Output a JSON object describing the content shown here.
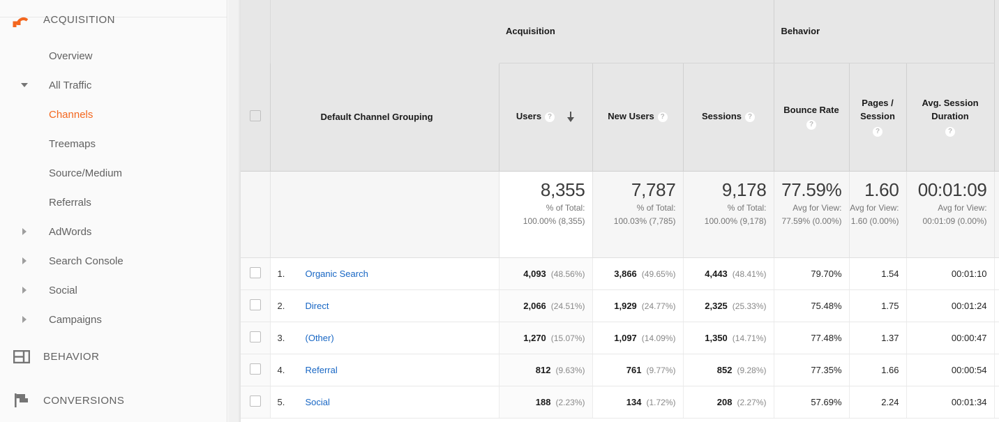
{
  "sidebar": {
    "sections": [
      {
        "label": "ACQUISITION",
        "icon": "acquisition-arrow-icon",
        "active": true
      },
      {
        "label": "BEHAVIOR",
        "icon": "behavior-layout-icon",
        "active": false
      },
      {
        "label": "CONVERSIONS",
        "icon": "conversions-flag-icon",
        "active": false
      }
    ],
    "items": [
      {
        "label": "Overview",
        "toggle": "none",
        "selected": false
      },
      {
        "label": "All Traffic",
        "toggle": "expanded",
        "selected": false
      },
      {
        "label": "Channels",
        "toggle": "none",
        "selected": true
      },
      {
        "label": "Treemaps",
        "toggle": "none",
        "selected": false
      },
      {
        "label": "Source/Medium",
        "toggle": "none",
        "selected": false
      },
      {
        "label": "Referrals",
        "toggle": "none",
        "selected": false
      },
      {
        "label": "AdWords",
        "toggle": "collapsed",
        "selected": false
      },
      {
        "label": "Search Console",
        "toggle": "collapsed",
        "selected": false
      },
      {
        "label": "Social",
        "toggle": "collapsed",
        "selected": false
      },
      {
        "label": "Campaigns",
        "toggle": "collapsed",
        "selected": false
      }
    ],
    "accent_color": "#f3671f"
  },
  "table": {
    "group_headers": {
      "acquisition": "Acquisition",
      "behavior": "Behavior"
    },
    "dimension_header": "Default Channel Grouping",
    "columns": [
      {
        "label": "Users",
        "help": "?",
        "sorted": true,
        "sort_dir": "descending"
      },
      {
        "label": "New Users",
        "help": "?",
        "sorted": false
      },
      {
        "label": "Sessions",
        "help": "?",
        "sorted": false
      },
      {
        "label": "Bounce Rate",
        "help": "?",
        "sorted": false
      },
      {
        "label": "Pages / Session",
        "help": "?",
        "sorted": false
      },
      {
        "label": "Avg. Session Duration",
        "help": "?",
        "sorted": false
      }
    ],
    "summary": [
      {
        "main": "8,355",
        "sub1": "% of Total:",
        "sub2": "100.00% (8,355)"
      },
      {
        "main": "7,787",
        "sub1": "% of Total:",
        "sub2": "100.03% (7,785)"
      },
      {
        "main": "9,178",
        "sub1": "% of Total:",
        "sub2": "100.00% (9,178)"
      },
      {
        "main": "77.59%",
        "sub1": "Avg for View:",
        "sub2": "77.59% (0.00%)"
      },
      {
        "main": "1.60",
        "sub1": "Avg for View:",
        "sub2": "1.60 (0.00%)"
      },
      {
        "main": "00:01:09",
        "sub1": "Avg for View:",
        "sub2": "00:01:09 (0.00%)"
      }
    ],
    "rows": [
      {
        "index": "1.",
        "channel": "Organic Search",
        "users": "4,093",
        "users_pct": "(48.56%)",
        "new_users": "3,866",
        "new_users_pct": "(49.65%)",
        "sessions": "4,443",
        "sessions_pct": "(48.41%)",
        "bounce_rate": "79.70%",
        "pages_session": "1.54",
        "avg_duration": "00:01:10"
      },
      {
        "index": "2.",
        "channel": "Direct",
        "users": "2,066",
        "users_pct": "(24.51%)",
        "new_users": "1,929",
        "new_users_pct": "(24.77%)",
        "sessions": "2,325",
        "sessions_pct": "(25.33%)",
        "bounce_rate": "75.48%",
        "pages_session": "1.75",
        "avg_duration": "00:01:24"
      },
      {
        "index": "3.",
        "channel": "(Other)",
        "users": "1,270",
        "users_pct": "(15.07%)",
        "new_users": "1,097",
        "new_users_pct": "(14.09%)",
        "sessions": "1,350",
        "sessions_pct": "(14.71%)",
        "bounce_rate": "77.48%",
        "pages_session": "1.37",
        "avg_duration": "00:00:47"
      },
      {
        "index": "4.",
        "channel": "Referral",
        "users": "812",
        "users_pct": "(9.63%)",
        "new_users": "761",
        "new_users_pct": "(9.77%)",
        "sessions": "852",
        "sessions_pct": "(9.28%)",
        "bounce_rate": "77.35%",
        "pages_session": "1.66",
        "avg_duration": "00:00:54"
      },
      {
        "index": "5.",
        "channel": "Social",
        "users": "188",
        "users_pct": "(2.23%)",
        "new_users": "134",
        "new_users_pct": "(1.72%)",
        "sessions": "208",
        "sessions_pct": "(2.27%)",
        "bounce_rate": "57.69%",
        "pages_session": "2.24",
        "avg_duration": "00:01:34"
      }
    ]
  },
  "chart_data": {
    "type": "table",
    "title": "Default Channel Grouping",
    "columns": [
      "Default Channel Grouping",
      "Users",
      "New Users",
      "Sessions",
      "Bounce Rate",
      "Pages / Session",
      "Avg. Session Duration"
    ],
    "categories": [
      "Organic Search",
      "Direct",
      "(Other)",
      "Referral",
      "Social"
    ],
    "series": [
      {
        "name": "Users",
        "values": [
          4093,
          2066,
          1270,
          812,
          188
        ],
        "total": 8355
      },
      {
        "name": "Users %",
        "values": [
          48.56,
          24.51,
          15.07,
          9.63,
          2.23
        ]
      },
      {
        "name": "New Users",
        "values": [
          3866,
          1929,
          1097,
          761,
          134
        ],
        "total": 7787
      },
      {
        "name": "New Users %",
        "values": [
          49.65,
          24.77,
          14.09,
          9.77,
          1.72
        ]
      },
      {
        "name": "Sessions",
        "values": [
          4443,
          2325,
          1350,
          852,
          208
        ],
        "total": 9178
      },
      {
        "name": "Sessions %",
        "values": [
          48.41,
          25.33,
          14.71,
          9.28,
          2.27
        ]
      },
      {
        "name": "Bounce Rate",
        "values": [
          79.7,
          75.48,
          77.48,
          77.35,
          57.69
        ],
        "average": 77.59
      },
      {
        "name": "Pages / Session",
        "values": [
          1.54,
          1.75,
          1.37,
          1.66,
          2.24
        ],
        "average": 1.6
      },
      {
        "name": "Avg. Session Duration",
        "values": [
          "00:01:10",
          "00:01:24",
          "00:00:47",
          "00:00:54",
          "00:01:34"
        ],
        "average": "00:01:09"
      }
    ],
    "sorted_by": "Users",
    "sort_direction": "descending"
  }
}
